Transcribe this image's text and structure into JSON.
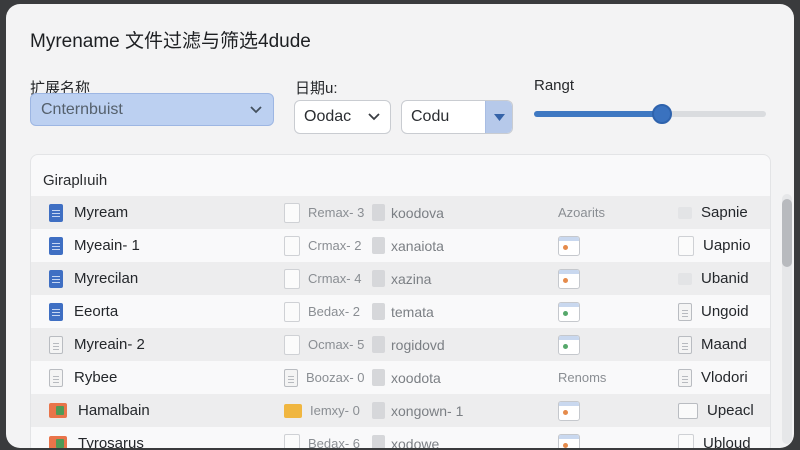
{
  "window": {
    "title": "Myrename 文件过滤与筛选4dude"
  },
  "filters": {
    "extension": {
      "label": "扩展名称",
      "value": "Cnternbuist"
    },
    "date": {
      "label": "日期u:",
      "value_a": "Oodac",
      "value_b": "Codu"
    },
    "range": {
      "label": "Rangt",
      "value": 0.55
    }
  },
  "list": {
    "header": "Girapl⁠ıuih",
    "rows": [
      {
        "name": "Myream",
        "icon": "doc-blue-icon",
        "code": "Remax- 3",
        "code_icon": "file-outline-icon",
        "file": "koodova",
        "file_icon": "file-gray-icon",
        "tag": "Azoarits",
        "tag_icon": "",
        "tail": "Sapnie",
        "tail_icon": "box-gray-icon"
      },
      {
        "name": "Myeain- 1",
        "icon": "doc-blue-icon",
        "code": "Crmax- 2",
        "code_icon": "file-outline-icon",
        "file": "xanaiota",
        "file_icon": "file-gray-icon",
        "tag": "",
        "tag_icon": "app-window-icon",
        "tail": "Uapnio",
        "tail_icon": "file-outline-icon"
      },
      {
        "name": "Myrecilan",
        "icon": "doc-blue-icon",
        "code": "Crmax- 4",
        "code_icon": "file-outline-icon",
        "file": "xazina",
        "file_icon": "file-gray-icon",
        "tag": "",
        "tag_icon": "app-window-icon",
        "tail": "Ubanid",
        "tail_icon": "box-gray-icon"
      },
      {
        "name": "Eeorta",
        "icon": "doc-blue-icon",
        "code": "Bedax- 2",
        "code_icon": "file-outline-icon",
        "file": "temata",
        "file_icon": "file-gray-icon",
        "tag": "",
        "tag_icon": "app-window-green-icon",
        "tail": "Ungoid",
        "tail_icon": "doc-gray-icon"
      },
      {
        "name": "Myreain- 2",
        "icon": "doc-gray-icon",
        "code": "Ocmax- 5",
        "code_icon": "file-outline-icon",
        "file": "rogidovd",
        "file_icon": "file-gray-icon",
        "tag": "",
        "tag_icon": "app-window-green-icon",
        "tail": "Maand",
        "tail_icon": "doc-gray-icon"
      },
      {
        "name": "Rybee",
        "icon": "doc-gray-icon",
        "code": "Boozax- 0",
        "code_icon": "doc-gray-icon",
        "file": "xoodota",
        "file_icon": "file-gray-icon",
        "tag": "Renoms",
        "tag_icon": "",
        "tail": "Vlodori",
        "tail_icon": "doc-gray-icon"
      },
      {
        "name": "Hamalbain",
        "icon": "image-icon",
        "code": "Iemxy- 0",
        "code_icon": "folder-yellow-icon",
        "file": "xongown- 1",
        "file_icon": "file-gray-icon",
        "tag": "",
        "tag_icon": "app-window-icon",
        "tail": "Upeacl",
        "tail_icon": "window-icon"
      },
      {
        "name": "Tyrosarus",
        "icon": "image-icon",
        "code": "Bedax- 6",
        "code_icon": "file-outline-icon",
        "file": "xodowe",
        "file_icon": "file-gray-icon",
        "tag": "",
        "tag_icon": "app-window-icon",
        "tail": "Ubloud",
        "tail_icon": "file-outline-icon"
      }
    ]
  },
  "colors": {
    "accent": "#3e78c2",
    "selected_bg": "#bcd0f1"
  }
}
